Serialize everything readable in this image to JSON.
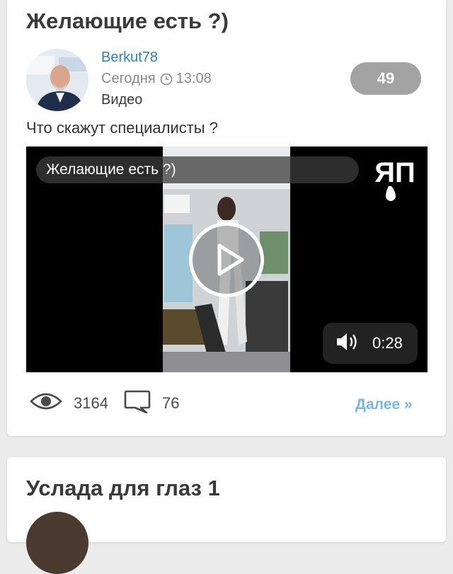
{
  "posts": [
    {
      "title": "Желающие есть ?)",
      "author": "Berkut78",
      "date": "Сегодня",
      "time": "13:08",
      "category": "Видео",
      "rating": "49",
      "text": "Что скажут специалисты ?",
      "video": {
        "title": "Желающие есть ?)",
        "duration": "0:28",
        "logo_text": "ЯП"
      },
      "views": "3164",
      "comments": "76",
      "more_label": "Далее »"
    },
    {
      "title": "Услада для глаз 1"
    }
  ],
  "colors": {
    "accent_link": "#2f7fb6",
    "more_link": "#7cb6de",
    "rating_badge": "#a3a3a3",
    "background": "#ececec"
  },
  "icons": [
    "clock-icon",
    "play-icon",
    "volume-icon",
    "eye-icon",
    "comment-icon"
  ]
}
